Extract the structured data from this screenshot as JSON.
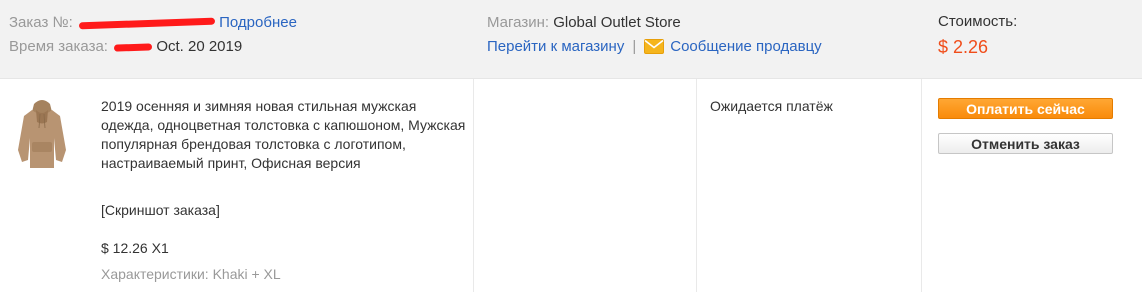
{
  "order": {
    "number_label": "Заказ №:",
    "details_link": "Подробнее",
    "time_label": "Время заказа:",
    "time_value": "Oct. 20 2019"
  },
  "store": {
    "label": "Магазин:",
    "name": "Global Outlet Store",
    "go_to_store": "Перейти к магазину",
    "separator": "|",
    "message_seller": "Сообщение продавцу"
  },
  "cost": {
    "label": "Стоимость:",
    "value": "$ 2.26"
  },
  "product": {
    "title": "2019 осенняя и зимняя новая стильная мужская одежда, одноцветная толстовка с капюшоном, Мужская популярная брендовая толстовка с логотипом, настраиваемый принт, Офисная версия",
    "snapshot": "[Скриншот заказа]",
    "unit_price": "$ 12.26 X1",
    "properties": "Характеристики: Khaki + XL"
  },
  "status": {
    "text": "Ожидается платёж"
  },
  "actions": {
    "pay_now": "Оплатить сейчас",
    "cancel_order": "Отменить заказ"
  },
  "colors": {
    "link": "#2a65c1",
    "price": "#f04d1a",
    "pay_button": "#f98b0b",
    "redaction": "#ff1a1a"
  },
  "icons": [
    "mail-icon",
    "hoodie-thumbnail"
  ]
}
